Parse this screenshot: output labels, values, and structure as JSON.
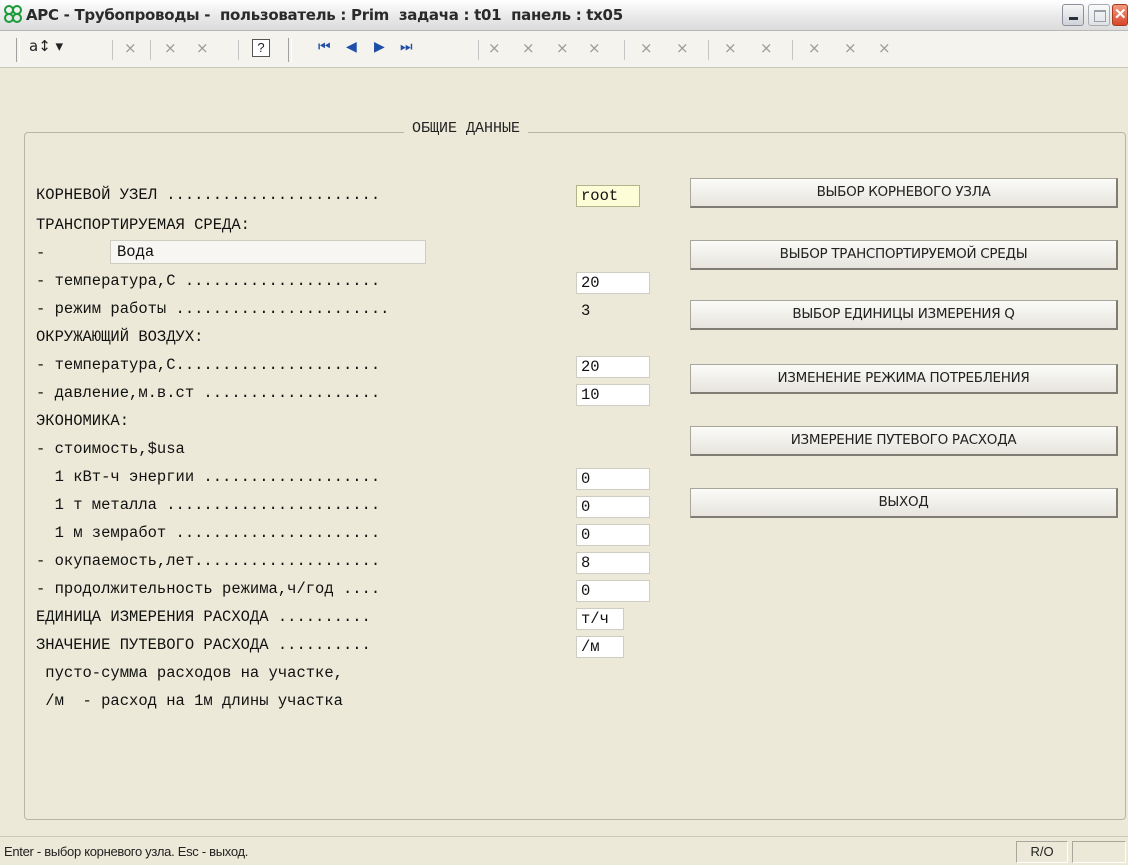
{
  "window": {
    "title": "АРС - Трубопроводы -  пользователь : Prim  задача : t01  панель : tx05"
  },
  "toolbar": {
    "sort_label": "a↕ ▾",
    "help_label": "?",
    "disabled_glyph": "×",
    "nav_first": "⏮",
    "nav_prev": "◀",
    "nav_next": "▶",
    "nav_last": "⏭"
  },
  "group": {
    "title": "ОБЩИЕ ДАННЫЕ"
  },
  "form": {
    "root_node_label": "КОРНЕВОЙ УЗЕЛ .......................",
    "root_node_value": "root",
    "medium_header": "ТРАНСПОРТИРУЕМАЯ СРЕДА:",
    "medium_dash": "-",
    "medium_value": "Вода",
    "medium_temp_label": "- температура,С .....................",
    "medium_temp_value": "20",
    "mode_label": "- режим работы .......................",
    "mode_value": "3",
    "air_header": "ОКРУЖАЮЩИЙ ВОЗДУХ:",
    "air_temp_label": "- температура,С......................",
    "air_temp_value": "20",
    "air_pressure_label": "- давление,м.в.ст ...................",
    "air_pressure_value": "10",
    "economy_header": "ЭКОНОМИКА:",
    "cost_header": "- стоимость,$usa",
    "energy_label": "  1 кВт-ч энергии ...................",
    "energy_value": "0",
    "metal_label": "  1 т металла .......................",
    "metal_value": "0",
    "earthwork_label": "  1 м земработ ......................",
    "earthwork_value": "0",
    "payback_label": "- окупаемость,лет....................",
    "payback_value": "8",
    "duration_label": "- продолжительность режима,ч/год ....",
    "duration_value": "0",
    "flow_unit_label": "ЕДИНИЦА ИЗМЕРЕНИЯ РАСХОДА ..........",
    "flow_unit_value": "т/ч",
    "path_flow_label": "ЗНАЧЕНИЕ ПУТЕВОГО РАСХОДА ..........",
    "path_flow_value": "/м",
    "note_line1": " пусто-сумма расходов на участке,",
    "note_line2": " /м  - расход на 1м длины участка"
  },
  "buttons": {
    "select_root": "ВЫБОР КОРНЕВОГО УЗЛА",
    "select_medium": "ВЫБОР ТРАНСПОРТИРУЕМОЙ СРЕДЫ",
    "select_unit": "ВЫБОР ЕДИНИЦЫ ИЗМЕРЕНИЯ Q",
    "change_mode": "ИЗМЕНЕНИЕ РЕЖИМА ПОТРЕБЛЕНИЯ",
    "path_flow": "ИЗМЕРЕНИЕ ПУТЕВОГО РАСХОДА",
    "exit": "ВЫХОД"
  },
  "status": {
    "hint": "Enter - выбор корневого узла.  Esc - выход.",
    "mode": "R/O"
  }
}
